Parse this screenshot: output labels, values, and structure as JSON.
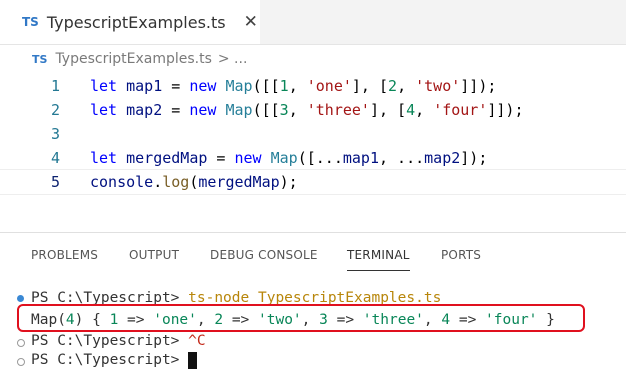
{
  "tab": {
    "badge": "TS",
    "filename": "TypescriptExamples.ts",
    "close_glyph": "✕"
  },
  "breadcrumb": {
    "badge": "TS",
    "file": "TypescriptExamples.ts",
    "sep": "> ..."
  },
  "editor": {
    "lines": [
      {
        "n": "1",
        "text": "let map1 = new Map([[1, 'one'], [2, 'two']]);"
      },
      {
        "n": "2",
        "text": "let map2 = new Map([[3, 'three'], [4, 'four']]);"
      },
      {
        "n": "3",
        "text": ""
      },
      {
        "n": "4",
        "text": "let mergedMap = new Map([...map1, ...map2]);"
      },
      {
        "n": "5",
        "text": "console.log(mergedMap);"
      }
    ]
  },
  "panel": {
    "tabs": [
      "PROBLEMS",
      "OUTPUT",
      "DEBUG CONSOLE",
      "TERMINAL",
      "PORTS"
    ],
    "active_tab": "TERMINAL"
  },
  "terminal": {
    "line1_prompt": "PS C:\\Typescript> ",
    "line1_cmd": "ts-node TypescriptExamples.ts",
    "output": "Map(4) { 1 => 'one', 2 => 'two', 3 => 'three', 4 => 'four' }",
    "line3_prompt": "PS C:\\Typescript> ",
    "line3_ctrl": "^C",
    "line4_prompt": "PS C:\\Typescript> "
  },
  "colors": {
    "ts_badge": "#3178c6",
    "highlight_border": "#e0101e",
    "status_dot": "#3a88d4"
  }
}
